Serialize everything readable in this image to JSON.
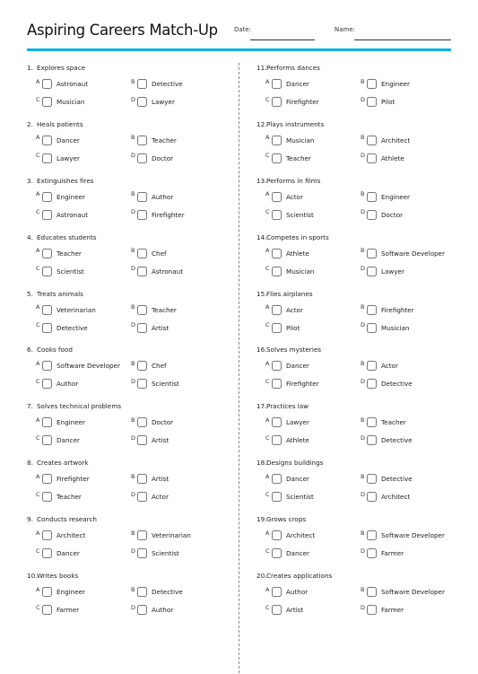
{
  "header": {
    "title": "Aspiring Careers Match-Up",
    "date_label": "Date:",
    "name_label": "Name:",
    "accent_color": "#0eb0e8"
  },
  "questions": [
    {
      "num": "1.",
      "text": "Explores space",
      "options": {
        "A": "Astronaut",
        "B": "Detective",
        "C": "Musician",
        "D": "Lawyer"
      }
    },
    {
      "num": "2.",
      "text": "Heals patients",
      "options": {
        "A": "Dancer",
        "B": "Teacher",
        "C": "Lawyer",
        "D": "Doctor"
      }
    },
    {
      "num": "3.",
      "text": "Extinguishes fires",
      "options": {
        "A": "Engineer",
        "B": "Author",
        "C": "Astronaut",
        "D": "Firefighter"
      }
    },
    {
      "num": "4.",
      "text": "Educates students",
      "options": {
        "A": "Teacher",
        "B": "Chef",
        "C": "Scientist",
        "D": "Astronaut"
      }
    },
    {
      "num": "5.",
      "text": "Treats animals",
      "options": {
        "A": "Veterinarian",
        "B": "Teacher",
        "C": "Detective",
        "D": "Artist"
      }
    },
    {
      "num": "6.",
      "text": "Cooks food",
      "options": {
        "A": "Software Developer",
        "B": "Chef",
        "C": "Author",
        "D": "Scientist"
      }
    },
    {
      "num": "7.",
      "text": "Solves technical problems",
      "options": {
        "A": "Engineer",
        "B": "Doctor",
        "C": "Dancer",
        "D": "Artist"
      }
    },
    {
      "num": "8.",
      "text": "Creates artwork",
      "options": {
        "A": "Firefighter",
        "B": "Artist",
        "C": "Teacher",
        "D": "Actor"
      }
    },
    {
      "num": "9.",
      "text": "Conducts research",
      "options": {
        "A": "Architect",
        "B": "Veterinarian",
        "C": "Dancer",
        "D": "Scientist"
      }
    },
    {
      "num": "10.",
      "text": "Writes books",
      "options": {
        "A": "Engineer",
        "B": "Detective",
        "C": "Farmer",
        "D": "Author"
      }
    },
    {
      "num": "11.",
      "text": "Performs dances",
      "options": {
        "A": "Dancer",
        "B": "Engineer",
        "C": "Firefighter",
        "D": "Pilot"
      }
    },
    {
      "num": "12.",
      "text": "Plays instruments",
      "options": {
        "A": "Musician",
        "B": "Architect",
        "C": "Teacher",
        "D": "Athlete"
      }
    },
    {
      "num": "13.",
      "text": "Performs in films",
      "options": {
        "A": "Actor",
        "B": "Engineer",
        "C": "Scientist",
        "D": "Doctor"
      }
    },
    {
      "num": "14.",
      "text": "Competes in sports",
      "options": {
        "A": "Athlete",
        "B": "Software Developer",
        "C": "Musician",
        "D": "Lawyer"
      }
    },
    {
      "num": "15.",
      "text": "Flies airplanes",
      "options": {
        "A": "Actor",
        "B": "Firefighter",
        "C": "Pilot",
        "D": "Musician"
      }
    },
    {
      "num": "16.",
      "text": "Solves mysteries",
      "options": {
        "A": "Dancer",
        "B": "Actor",
        "C": "Firefighter",
        "D": "Detective"
      }
    },
    {
      "num": "17.",
      "text": "Practices law",
      "options": {
        "A": "Lawyer",
        "B": "Teacher",
        "C": "Athlete",
        "D": "Detective"
      }
    },
    {
      "num": "18.",
      "text": "Designs buildings",
      "options": {
        "A": "Dancer",
        "B": "Detective",
        "C": "Scientist",
        "D": "Architect"
      }
    },
    {
      "num": "19.",
      "text": "Grows crops",
      "options": {
        "A": "Architect",
        "B": "Software Developer",
        "C": "Dancer",
        "D": "Farmer"
      }
    },
    {
      "num": "20.",
      "text": "Creates applications",
      "options": {
        "A": "Author",
        "B": "Software Developer",
        "C": "Artist",
        "D": "Farmer"
      }
    }
  ],
  "option_letters": [
    "A",
    "B",
    "C",
    "D"
  ]
}
